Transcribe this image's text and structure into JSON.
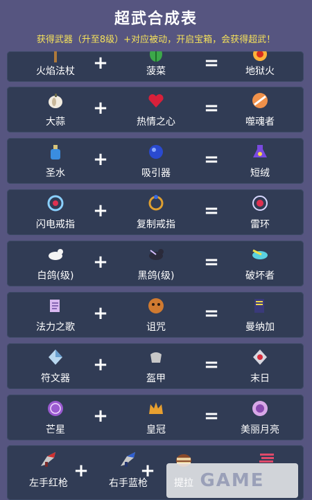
{
  "header": {
    "title": "超武合成表",
    "subtitle": "获得武器（升至8级）+对应被动，开启宝箱，会获得超武！"
  },
  "operators": {
    "plus": "+",
    "equals": "="
  },
  "rows": [
    {
      "weapon": {
        "label": "火焰法杖",
        "icon": "fire-wand-icon"
      },
      "passive": {
        "label": "菠菜",
        "icon": "spinach-icon"
      },
      "result": {
        "label": "地狱火",
        "icon": "hellfire-icon"
      }
    },
    {
      "weapon": {
        "label": "大蒜",
        "icon": "garlic-icon"
      },
      "passive": {
        "label": "热情之心",
        "icon": "heart-icon"
      },
      "result": {
        "label": "噬魂者",
        "icon": "soul-eater-icon"
      }
    },
    {
      "weapon": {
        "label": "圣水",
        "icon": "holy-water-icon"
      },
      "passive": {
        "label": "吸引器",
        "icon": "attractorb-icon"
      },
      "result": {
        "label": "短绒",
        "icon": "la-borra-icon"
      }
    },
    {
      "weapon": {
        "label": "闪电戒指",
        "icon": "lightning-ring-icon"
      },
      "passive": {
        "label": "复制戒指",
        "icon": "duplicator-icon"
      },
      "result": {
        "label": "雷环",
        "icon": "thunder-loop-icon"
      }
    },
    {
      "weapon": {
        "label": "白鸽(级)",
        "icon": "white-dove-icon"
      },
      "passive": {
        "label": "黑鸽(级)",
        "icon": "black-dove-icon"
      },
      "result": {
        "label": "破坏者",
        "icon": "destroyer-bird-icon"
      }
    },
    {
      "weapon": {
        "label": "法力之歌",
        "icon": "song-of-mana-icon"
      },
      "passive": {
        "label": "诅咒",
        "icon": "curse-icon"
      },
      "result": {
        "label": "曼纳加",
        "icon": "mannajja-icon"
      }
    },
    {
      "weapon": {
        "label": "符文器",
        "icon": "runetracer-icon"
      },
      "passive": {
        "label": "盔甲",
        "icon": "armor-icon"
      },
      "result": {
        "label": "末日",
        "icon": "nodestroy-icon"
      }
    },
    {
      "weapon": {
        "label": "芒星",
        "icon": "pentagram-icon"
      },
      "passive": {
        "label": "皇冠",
        "icon": "crown-icon"
      },
      "result": {
        "label": "美丽月亮",
        "icon": "gorgeous-moon-icon"
      }
    }
  ],
  "last_row": {
    "item1": {
      "label": "左手红枪",
      "icon": "red-gun-icon"
    },
    "item2": {
      "label": "右手蓝枪",
      "icon": "blue-gun-icon"
    },
    "item3": {
      "label": "提拉",
      "icon": "tiragisu-icon"
    },
    "result": {
      "icon": "phieraggi-icon"
    }
  },
  "watermark": {
    "text": "GAME"
  },
  "colors": {
    "background": "#565580",
    "row": "#313c55",
    "title": "#ffffff",
    "subtitle": "#f6e25a"
  }
}
